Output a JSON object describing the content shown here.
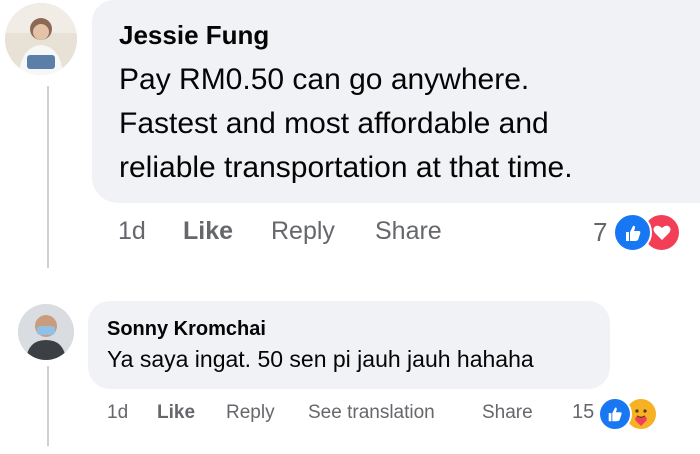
{
  "comments": [
    {
      "author": "Jessie Fung",
      "lines": [
        "Pay RM0.50 can go anywhere.",
        "Fastest and most affordable and",
        "reliable transportation at that time."
      ],
      "time": "1d",
      "actions": [
        "Like",
        "Reply",
        "Share"
      ],
      "reaction_count": "7",
      "reactions": [
        "like-icon",
        "love-icon"
      ]
    },
    {
      "author": "Sonny Kromchai",
      "text": "Ya saya ingat. 50 sen pi jauh jauh hahaha",
      "time": "1d",
      "actions": [
        "Like",
        "Reply",
        "See translation",
        "Share"
      ],
      "reaction_count": "15",
      "reactions": [
        "like-icon",
        "care-icon"
      ]
    }
  ],
  "colors": {
    "bubble": "#f0f2f5",
    "action_text": "#65676b",
    "like_blue": "#1877f2",
    "love_red": "#f33e58",
    "care_yellow": "#f7b125"
  }
}
